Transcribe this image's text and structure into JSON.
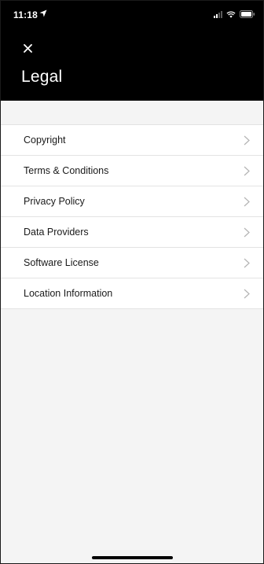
{
  "status_bar": {
    "time": "11:18"
  },
  "header": {
    "title": "Legal"
  },
  "menu": {
    "items": [
      {
        "label": "Copyright"
      },
      {
        "label": "Terms & Conditions"
      },
      {
        "label": "Privacy Policy"
      },
      {
        "label": "Data Providers"
      },
      {
        "label": "Software License"
      },
      {
        "label": "Location Information"
      }
    ]
  },
  "colors": {
    "header_bg": "#000000",
    "page_bg": "#f4f4f4",
    "item_bg": "#ffffff",
    "divider": "#e3e3e3",
    "chevron": "#b3b3b3"
  }
}
